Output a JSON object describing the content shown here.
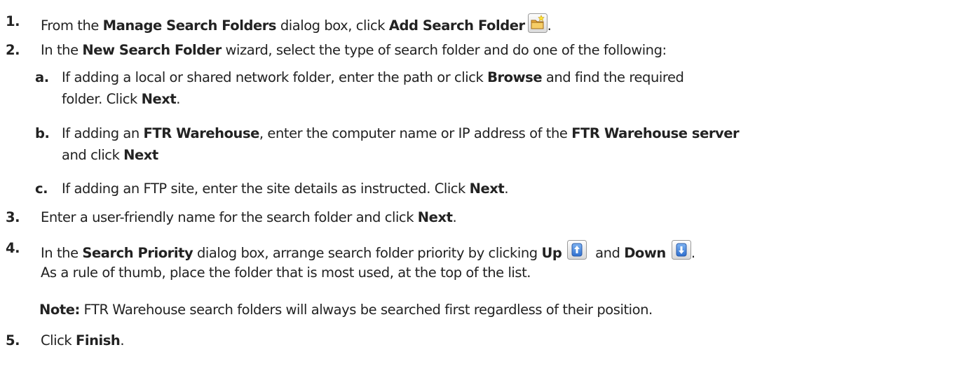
{
  "steps": [
    {
      "num": "1.",
      "pre": "From the ",
      "b1": "Manage Search Folders",
      "mid": " dialog box, click ",
      "b2": "Add Search Folder",
      "end": ".",
      "icon": "add-folder-icon"
    },
    {
      "num": "2.",
      "pre": "In the ",
      "b1": "New Search Folder",
      "post": " wizard, select the type of search folder and do one of the following:",
      "subs": [
        {
          "num": "a.",
          "l1_pre": "If adding a local or shared network folder, enter the path or click ",
          "l1_b": "Browse",
          "l1_post": " and find the required",
          "l2_pre": "folder.  Click ",
          "l2_b": "Next",
          "l2_post": "."
        },
        {
          "num": "b.",
          "l1_pre": "If adding an ",
          "l1_b1": "FTR Warehouse",
          "l1_mid": ", enter the computer name or IP address of the ",
          "l1_b2": "FTR Warehouse server",
          "l2_pre": "and click ",
          "l2_b": "Next"
        },
        {
          "num": "c.",
          "pre": "If adding an FTP site, enter the site details as instructed.  Click ",
          "b": "Next",
          "post": "."
        }
      ]
    },
    {
      "num": "3.",
      "pre": "Enter a user-friendly name for the search folder and click ",
      "b": "Next",
      "post": "."
    },
    {
      "num": "4.",
      "pre": "In the ",
      "b1": "Search Priority",
      "mid": " dialog box, arrange search folder priority by clicking ",
      "b2": "Up",
      "and": " and ",
      "b3": "Down",
      "end": ".",
      "l2": "As a rule of thumb, place the folder that is most used, at the top of the list.",
      "icons": [
        "arrow-up-icon",
        "arrow-down-icon"
      ]
    },
    {
      "num": "5.",
      "pre": "Click ",
      "b": "Finish",
      "post": "."
    }
  ],
  "note": {
    "label": "Note:",
    "text": " FTR Warehouse search folders will always be searched first regardless of their position."
  },
  "colors": {
    "text": "#222222",
    "button_blue": "#4a86d8",
    "folder_yellow": "#f2c25a"
  }
}
